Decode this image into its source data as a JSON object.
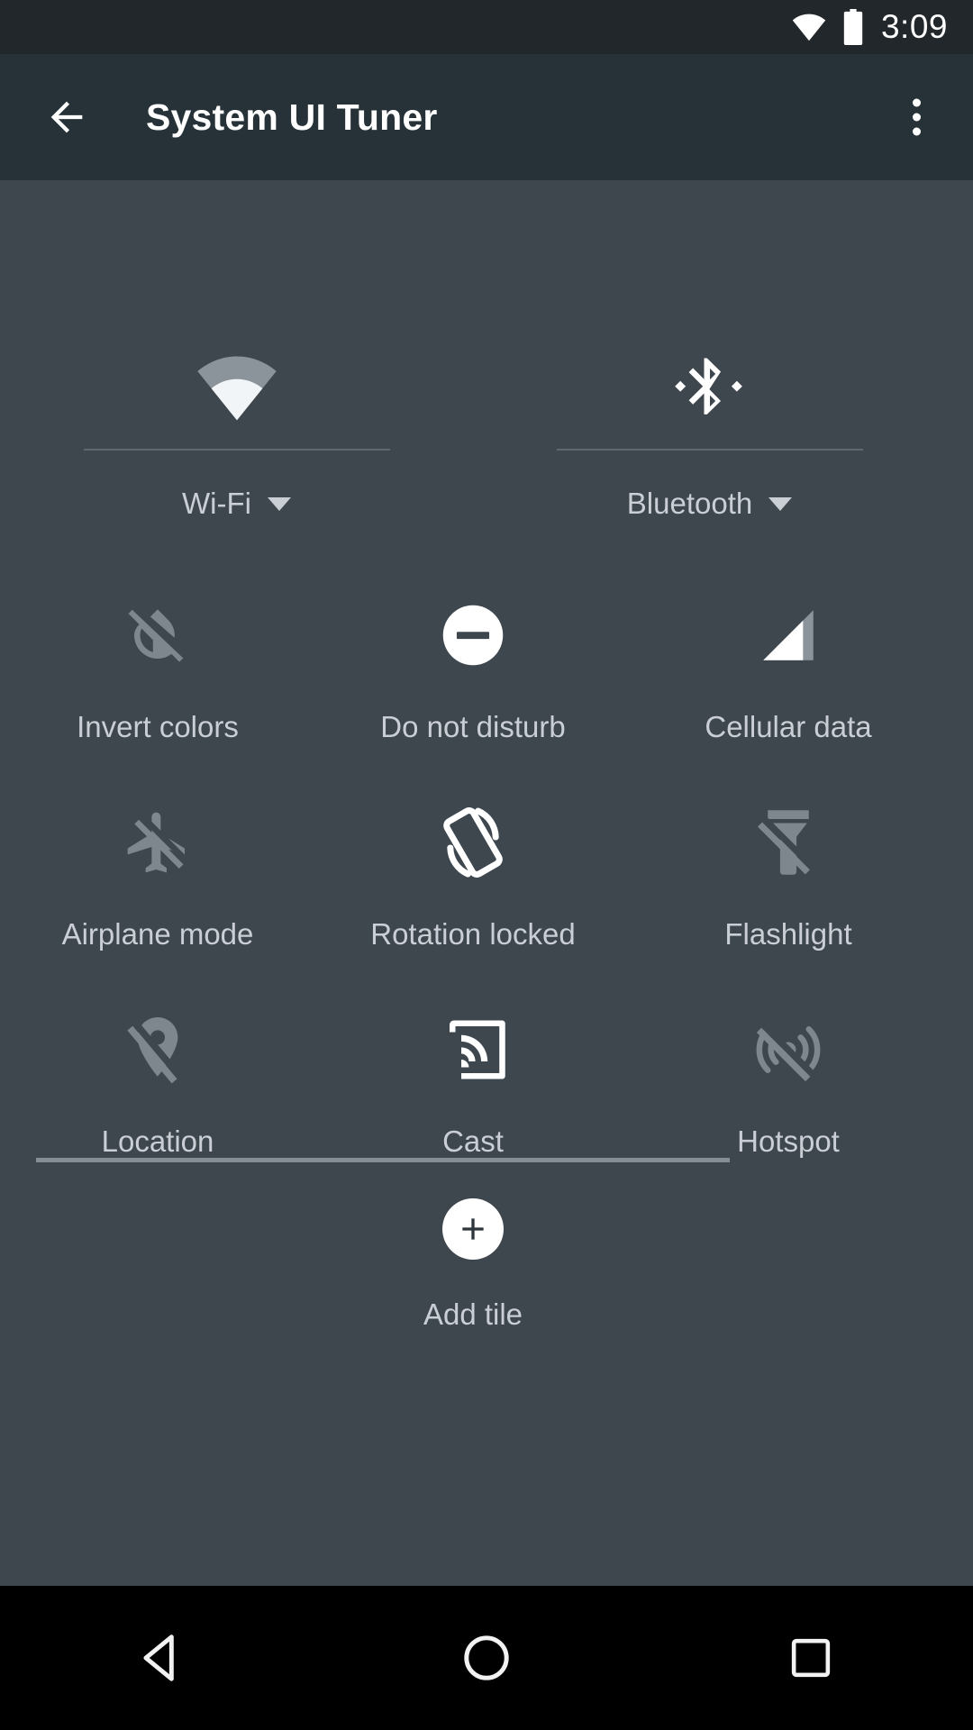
{
  "status_bar": {
    "wifi_icon": "wifi-icon",
    "battery_icon": "battery-full-icon",
    "clock": "3:09"
  },
  "app_bar": {
    "back_icon": "arrow-back-icon",
    "title": "System UI Tuner",
    "overflow_icon": "overflow-menu-icon"
  },
  "quick_settings": {
    "dual_tiles": [
      {
        "label": "Wi-Fi",
        "icon": "wifi-icon",
        "state": "on",
        "has_caret": true
      },
      {
        "label": "Bluetooth",
        "icon": "bluetooth-icon",
        "state": "on",
        "has_caret": true
      }
    ],
    "tiles": [
      {
        "label": "Invert colors",
        "icon": "invert-colors-off-icon",
        "state": "off"
      },
      {
        "label": "Do not disturb",
        "icon": "do-not-disturb-icon",
        "state": "on"
      },
      {
        "label": "Cellular data",
        "icon": "cellular-signal-icon",
        "state": "on"
      },
      {
        "label": "Airplane mode",
        "icon": "airplane-mode-off-icon",
        "state": "off"
      },
      {
        "label": "Rotation locked",
        "icon": "rotation-locked-icon",
        "state": "on"
      },
      {
        "label": "Flashlight",
        "icon": "flashlight-off-icon",
        "state": "off"
      },
      {
        "label": "Location",
        "icon": "location-off-icon",
        "state": "off"
      },
      {
        "label": "Cast",
        "icon": "cast-icon",
        "state": "on"
      },
      {
        "label": "Hotspot",
        "icon": "hotspot-off-icon",
        "state": "off"
      }
    ],
    "add_tile": {
      "label": "Add tile",
      "icon": "plus-icon"
    }
  },
  "nav_bar": {
    "back": "nav-back-triangle-icon",
    "home": "nav-home-circle-icon",
    "recents": "nav-recents-square-icon"
  },
  "colors": {
    "status_bar_bg": "#21272b",
    "app_bar_bg": "#263238",
    "panel_bg": "#3e464e",
    "nav_bar_bg": "#000000",
    "label_text": "#c9cfd4",
    "icon_on": "#ffffff",
    "icon_off": "#7e878e",
    "divider": "#868e95"
  }
}
